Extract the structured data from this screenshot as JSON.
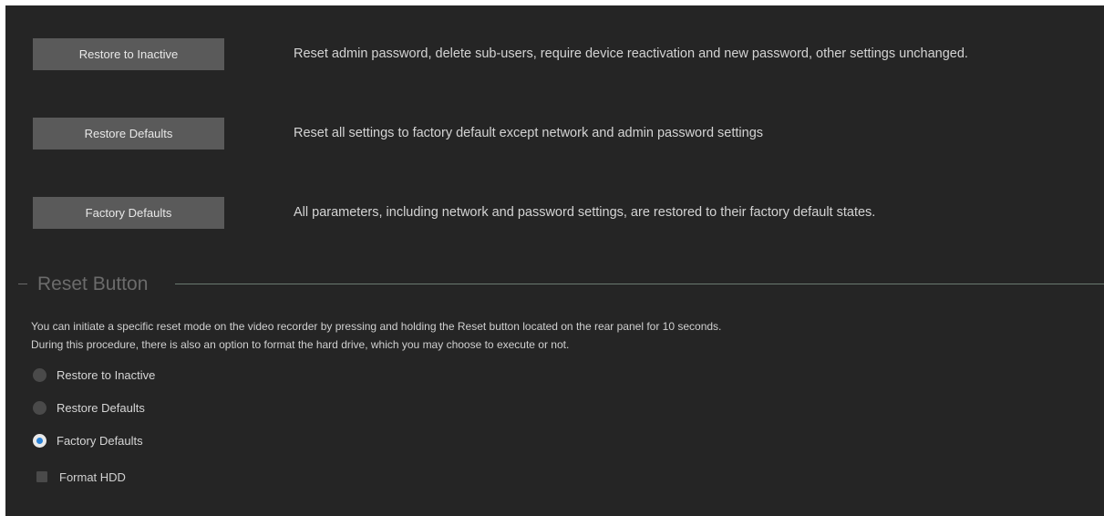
{
  "actions": [
    {
      "button_label": "Restore to Inactive",
      "description": "Reset admin password, delete sub-users, require device reactivation and new password, other settings unchanged."
    },
    {
      "button_label": "Restore Defaults",
      "description": "Reset all settings to factory default except network and admin password settings"
    },
    {
      "button_label": "Factory Defaults",
      "description": "All parameters, including network and password settings, are restored to their factory default states."
    }
  ],
  "reset_button_section": {
    "title": "Reset Button",
    "info_line_1": "You can initiate a specific reset mode on the video recorder by pressing and holding the Reset button located on the rear panel for 10 seconds.",
    "info_line_2": "During this procedure, there is also an option to format the hard drive, which you may choose to execute or not.",
    "options": [
      {
        "label": "Restore to Inactive",
        "selected": false
      },
      {
        "label": "Restore Defaults",
        "selected": false
      },
      {
        "label": "Factory Defaults",
        "selected": true
      }
    ],
    "format_hdd": {
      "label": "Format HDD",
      "checked": false
    }
  },
  "colors": {
    "panel_background": "#252525",
    "button_background": "#5a5a5a",
    "radio_selected_accent": "#2b83d8"
  }
}
